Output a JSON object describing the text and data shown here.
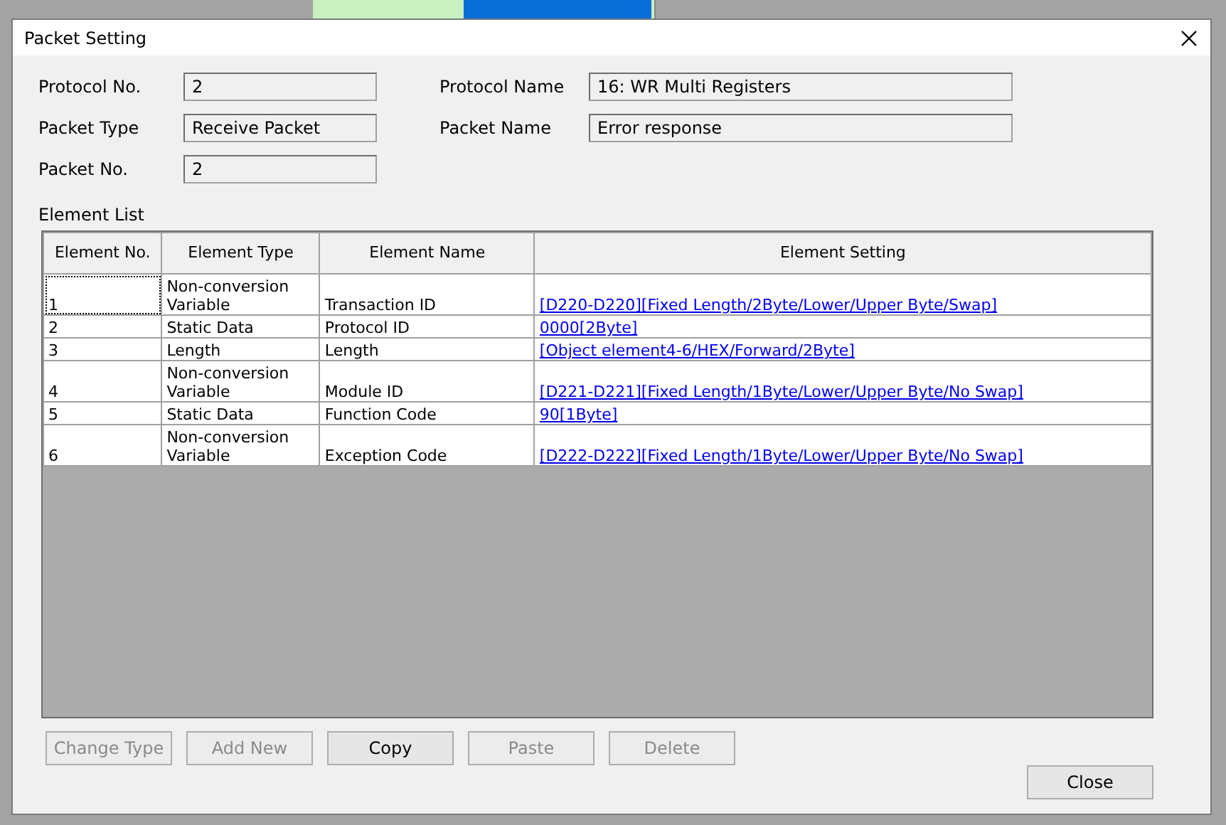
{
  "window": {
    "title": "Packet Setting"
  },
  "fields": [
    {
      "label": "Protocol No.",
      "value": "2"
    },
    {
      "label": "Protocol Name",
      "value": "16: WR Multi Registers"
    },
    {
      "label": "Packet Type",
      "value": "Receive Packet"
    },
    {
      "label": "Packet Name",
      "value": "Error response"
    },
    {
      "label": "Packet No.",
      "value": "2"
    }
  ],
  "element_list": {
    "title": "Element List",
    "columns": [
      "Element No.",
      "Element Type",
      "Element Name",
      "Element Setting"
    ],
    "rows": [
      {
        "no": "1",
        "type": "Non-conversion Variable",
        "name": "Transaction ID",
        "setting": "[D220-D220][Fixed Length/2Byte/Lower/Upper Byte/Swap]",
        "selected": true
      },
      {
        "no": "2",
        "type": "Static Data",
        "name": "Protocol ID",
        "setting": "0000[2Byte]",
        "selected": false
      },
      {
        "no": "3",
        "type": "Length",
        "name": "Length",
        "setting": "[Object element4-6/HEX/Forward/2Byte]",
        "selected": false
      },
      {
        "no": "4",
        "type": "Non-conversion Variable",
        "name": "Module ID",
        "setting": "[D221-D221][Fixed Length/1Byte/Lower/Upper Byte/No Swap]",
        "selected": false
      },
      {
        "no": "5",
        "type": "Static Data",
        "name": "Function Code",
        "setting": "90[1Byte]",
        "selected": false
      },
      {
        "no": "6",
        "type": "Non-conversion Variable",
        "name": "Exception Code",
        "setting": "[D222-D222][Fixed Length/1Byte/Lower/Upper Byte/No Swap]",
        "selected": false
      }
    ]
  },
  "buttons": [
    {
      "label": "Change Type",
      "disabled": true
    },
    {
      "label": "Add New",
      "disabled": true
    },
    {
      "label": "Copy",
      "disabled": false
    },
    {
      "label": "Paste",
      "disabled": true
    },
    {
      "label": "Delete",
      "disabled": true
    }
  ],
  "close_button": {
    "label": "Close"
  }
}
